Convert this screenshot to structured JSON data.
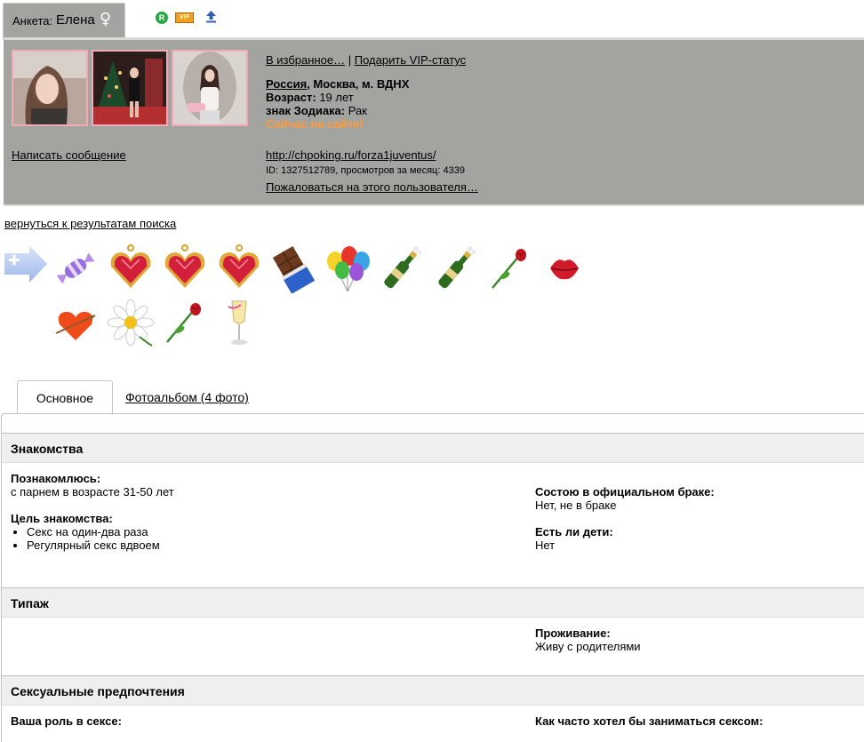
{
  "profile": {
    "tab_label": "Анкета:",
    "name": "Елена",
    "gender_symbol": "♀",
    "r_badge": "R",
    "vip_badge": "VIP"
  },
  "actions": {
    "favorites": "В избранное…",
    "separator": "|",
    "gift_vip": "Подарить VIP-статус",
    "write_message": "Написать сообщение",
    "back_to_results": "вернуться к результатам поиска",
    "report": "Пожаловаться на этого пользователя…"
  },
  "info": {
    "country": "Россия",
    "location_rest": ", Москва, м. ВДНХ",
    "age_label": "Возраст:",
    "age_value": " 19 лет",
    "zodiac_label": "знак Зодиака:",
    "zodiac_value": " Рак",
    "online": "Сейчас на сайте!",
    "profile_url": "http://chpoking.ru/forza1juventus/",
    "stats": "ID: 1327512789, просмотров за месяц: 4339"
  },
  "gifts": [
    "candy",
    "ruby-heart",
    "ruby-heart",
    "ruby-heart",
    "chocolate",
    "balloons",
    "champagne",
    "champagne",
    "rose",
    "lips",
    "heart-arrow",
    "daisy",
    "rose",
    "champagne-glass"
  ],
  "tabs": {
    "main": "Основное",
    "album": "Фотоальбом (4 фото)"
  },
  "sections": {
    "dating": {
      "title": "Знакомства",
      "meet_label": "Познакомлюсь:",
      "meet_value": "с парнем в возрасте 31-50 лет",
      "goal_label": "Цель знакомства:",
      "goals": [
        "Секс на один-два раза",
        "Регулярный секс вдвоем"
      ],
      "married_label": "Состою в официальном браке:",
      "married_value": "Нет, не в браке",
      "kids_label": "Есть ли дети:",
      "kids_value": "Нет"
    },
    "type": {
      "title": "Типаж",
      "living_label": "Проживание:",
      "living_value": "Живу с родителями"
    },
    "sex": {
      "title": "Сексуальные предпочтения",
      "role_label": "Ваша роль в сексе:",
      "freq_label": "Как часто хотел бы заниматься сексом:"
    }
  },
  "colors": {
    "panel": "#a3a3a0",
    "online": "#ff9b3a",
    "photo_border": "#f3a9b8",
    "section_bg": "#efefef"
  }
}
